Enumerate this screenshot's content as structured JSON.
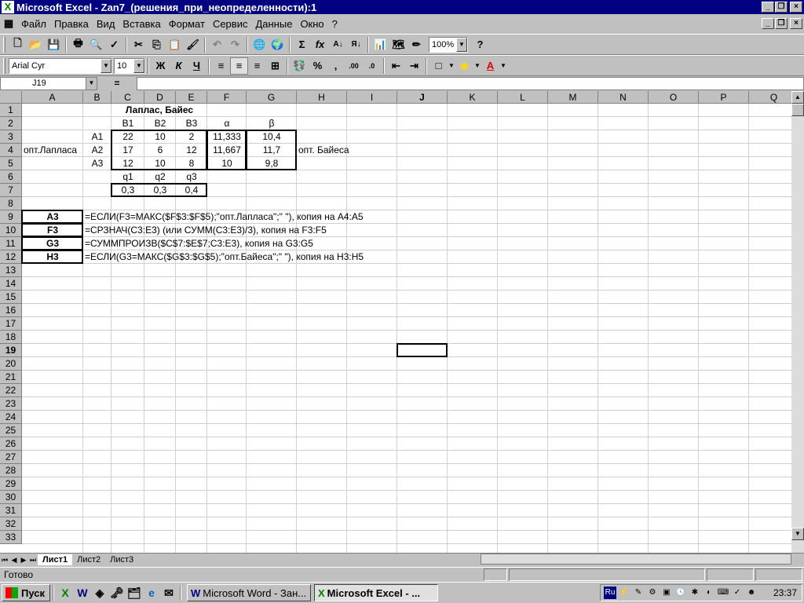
{
  "window": {
    "title": "Microsoft Excel - Zan7_(решения_при_неопределенности):1"
  },
  "menu": [
    "Файл",
    "Правка",
    "Вид",
    "Вставка",
    "Формат",
    "Сервис",
    "Данные",
    "Окно",
    "?"
  ],
  "toolbar": {
    "zoom": "100%",
    "font": "Arial Cyr",
    "size": "10",
    "bold": "Ж",
    "italic": "К",
    "underline": "Ч",
    "percent": "%",
    "comma": ","
  },
  "formula_bar": {
    "name_box": "J19",
    "equals": "=",
    "content": ""
  },
  "columns": [
    "A",
    "B",
    "C",
    "D",
    "E",
    "F",
    "G",
    "H",
    "I",
    "J",
    "K",
    "L",
    "M",
    "N",
    "O",
    "P",
    "Q"
  ],
  "rows": [
    "1",
    "2",
    "3",
    "4",
    "5",
    "6",
    "7",
    "8",
    "9",
    "10",
    "11",
    "12",
    "13",
    "14",
    "15",
    "16",
    "17",
    "18",
    "19",
    "20",
    "21",
    "22",
    "23",
    "24",
    "25",
    "26",
    "27",
    "28",
    "29",
    "30",
    "31",
    "32",
    "33"
  ],
  "cells": {
    "C1": "Лаплас, Байес",
    "C2": "B1",
    "D2": "B2",
    "E2": "B3",
    "F2": "α",
    "G2": "β",
    "B3": "A1",
    "C3": "22",
    "D3": "10",
    "E3": "2",
    "F3": "11,333",
    "G3": "10,4",
    "A4": "опт.Лапласа",
    "B4": "A2",
    "C4": "17",
    "D4": "6",
    "E4": "12",
    "F4": "11,667",
    "G4": "11,7",
    "H4": "опт. Байеса",
    "B5": "A3",
    "C5": "12",
    "D5": "10",
    "E5": "8",
    "F5": "10",
    "G5": "9,8",
    "C6": "q1",
    "D6": "q2",
    "E6": "q3",
    "C7": "0,3",
    "D7": "0,3",
    "E7": "0,4",
    "A9": "A3",
    "B9": "=ЕСЛИ(F3=МАКС($F$3:$F$5);\"опт.Лапласа\";\" \"), копия на A4:A5",
    "A10": "F3",
    "B10": "=СРЗНАЧ(C3:E3) (или СУММ(C3:E3)/3), копия на F3:F5",
    "A11": "G3",
    "B11": "=СУММПРОИЗВ($C$7:$E$7;C3:E3), копия на G3:G5",
    "A12": "H3",
    "B12": "=ЕСЛИ(G3=МАКС($G$3:$G$5);\"опт.Байеса\";\" \"), копия на H3:H5"
  },
  "sheet_tabs": [
    "Лист1",
    "Лист2",
    "Лист3"
  ],
  "status": "Готово",
  "taskbar": {
    "start": "Пуск",
    "tasks": [
      "Microsoft Word - Зан...",
      "Microsoft Excel - ..."
    ],
    "lang": "Ru",
    "clock": "23:37"
  }
}
